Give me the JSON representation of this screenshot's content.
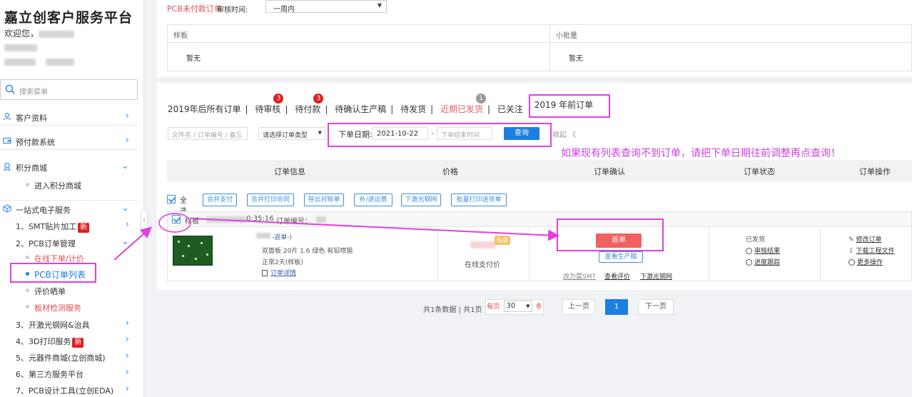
{
  "sidebar": {
    "brand": "嘉立创客户服务平台",
    "welcome": "欢迎您，",
    "search_placeholder": "搜索菜单",
    "menu": [
      {
        "label": "客户资料",
        "icon": "user-icon",
        "chevron": "›"
      },
      {
        "label": "预付款系统",
        "icon": "wallet-icon",
        "chevron": "›"
      },
      {
        "label": "积分商城",
        "icon": "points-icon",
        "chevron": "⌄"
      }
    ],
    "points_sub": "进入积分商城",
    "onestop": {
      "label": "一站式电子服务",
      "icon": "box-icon",
      "chevron": "⌄"
    },
    "services": [
      {
        "label": "1、SMT贴片加工",
        "badge": "新"
      },
      {
        "label": "2、PCB订单管理",
        "badge": ""
      },
      {
        "label": "3、开激光钢网&治具",
        "badge": ""
      },
      {
        "label": "4、3D打印服务",
        "badge": "新"
      },
      {
        "label": "5、元器件商城(立创商城)",
        "badge": ""
      },
      {
        "label": "6、第三方服务平台",
        "badge": ""
      },
      {
        "label": "7、PCB设计工具(立创EDA)",
        "badge": ""
      }
    ],
    "pcb_sub": [
      {
        "label": "在线下单/计价",
        "color": "#e05050"
      },
      {
        "label": "PCB订单列表",
        "color": "#1a7fe0"
      },
      {
        "label": "评价晒单",
        "color": "#333333"
      },
      {
        "label": "板材检测服务",
        "color": "#e05050"
      }
    ]
  },
  "top": {
    "unpaid_label": "PCB未付款订单",
    "audit_time_label": "审核时间:",
    "audit_time_value": "一周内",
    "sample_header": "样板",
    "sample_value": "暂无",
    "small_batch_header": "小批量",
    "small_batch_value": "暂无"
  },
  "tabs": [
    {
      "label": "2019年后所有订单",
      "count": ""
    },
    {
      "label": "待审核",
      "count": "3"
    },
    {
      "label": "待付款",
      "count": "3"
    },
    {
      "label": "待确认生产稿",
      "count": ""
    },
    {
      "label": "待发货",
      "count": ""
    },
    {
      "label": "近期已发货",
      "count": "1"
    },
    {
      "label": "已关注",
      "count": ""
    },
    {
      "label": "2019 年前订单",
      "count": ""
    }
  ],
  "filter": {
    "search_placeholder": "文件名 / 订单编号 / 备忘",
    "type_placeholder": "请选择订单类型",
    "date_label": "下单日期:",
    "date_start": "2021-10-22",
    "date_sep": "-",
    "date_end_placeholder": "下单结束时间",
    "query_label": "查询",
    "collapse_label": "收起 《"
  },
  "hint": "如果现有列表查询不到订单，请把下单日期往前调整再点查询！",
  "columns": [
    "订单信息",
    "价格",
    "订单确认",
    "订单状态",
    "订单操作"
  ],
  "batch": {
    "select_all": "全选",
    "buttons": [
      "合并支付",
      "合并打印合同",
      "导出对账单",
      "补/退运费",
      "下激光钢网",
      "批量打印送货单"
    ]
  },
  "order": {
    "type": "样板",
    "time": "0:35:16",
    "order_no_label": "订单编号：",
    "reorder_tag": "-返单-)",
    "spec": "双面板  20片  1.6  绿色  有铅喷锡",
    "delivery": "正常2天(样板)",
    "detail_link": "订单详情",
    "pay_tag": "包邮",
    "pay_method": "在线支付价",
    "return_btn": "返单",
    "view_prod_btn": "查看生产稿",
    "links": [
      "改为需SMT",
      "查看评价",
      "下激光钢网"
    ],
    "status": "已发货",
    "status_links": [
      "审核结果",
      "进度跟踪"
    ],
    "ops": [
      "修改订单",
      "下载工程文件",
      "更多操作"
    ]
  },
  "pager": {
    "summary": "共1条数据 | 共1页",
    "per_page_label": "每页",
    "per_page_value": "30",
    "per_page_unit": "条",
    "prev": "上一页",
    "current": "1",
    "next": "下一页"
  }
}
